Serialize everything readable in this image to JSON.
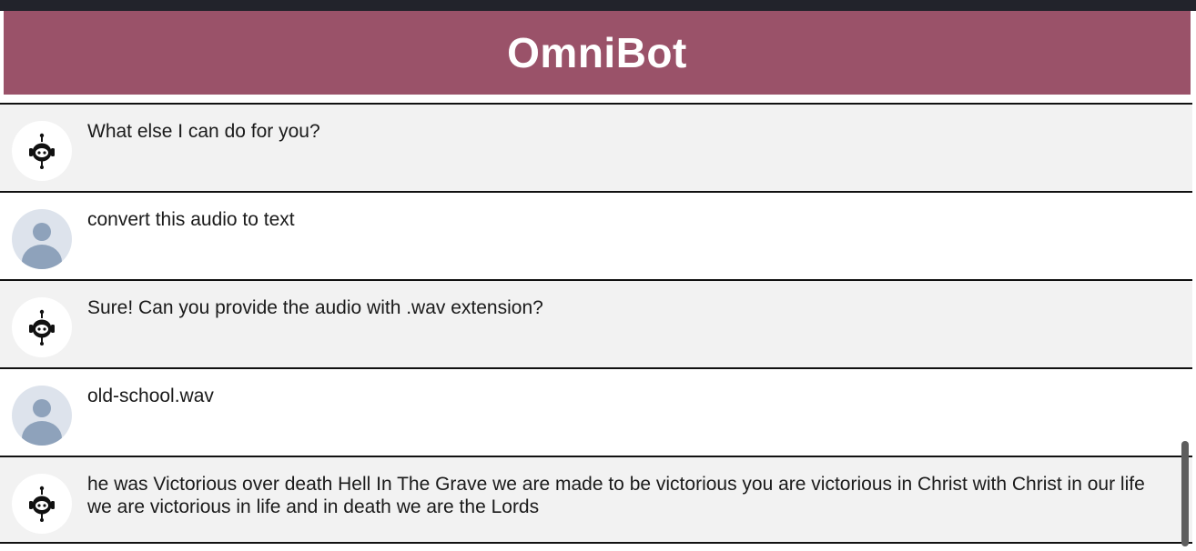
{
  "app": {
    "title": "OmniBot",
    "header_color": "#9a5269"
  },
  "messages": [
    {
      "sender": "bot",
      "avatar_icon": "robot-icon",
      "text": "What else I can do for you?"
    },
    {
      "sender": "user",
      "avatar_icon": "user-avatar-icon",
      "text": "convert this audio to text"
    },
    {
      "sender": "bot",
      "avatar_icon": "robot-icon",
      "text": "Sure! Can you provide the audio with .wav extension?"
    },
    {
      "sender": "user",
      "avatar_icon": "user-avatar-icon",
      "text": "old-school.wav"
    },
    {
      "sender": "bot",
      "avatar_icon": "robot-icon",
      "text": "he was Victorious over death Hell In The Grave we are made to be victorious you are victorious in Christ with Christ in our life we are victorious in life and in death we are the Lords"
    }
  ]
}
